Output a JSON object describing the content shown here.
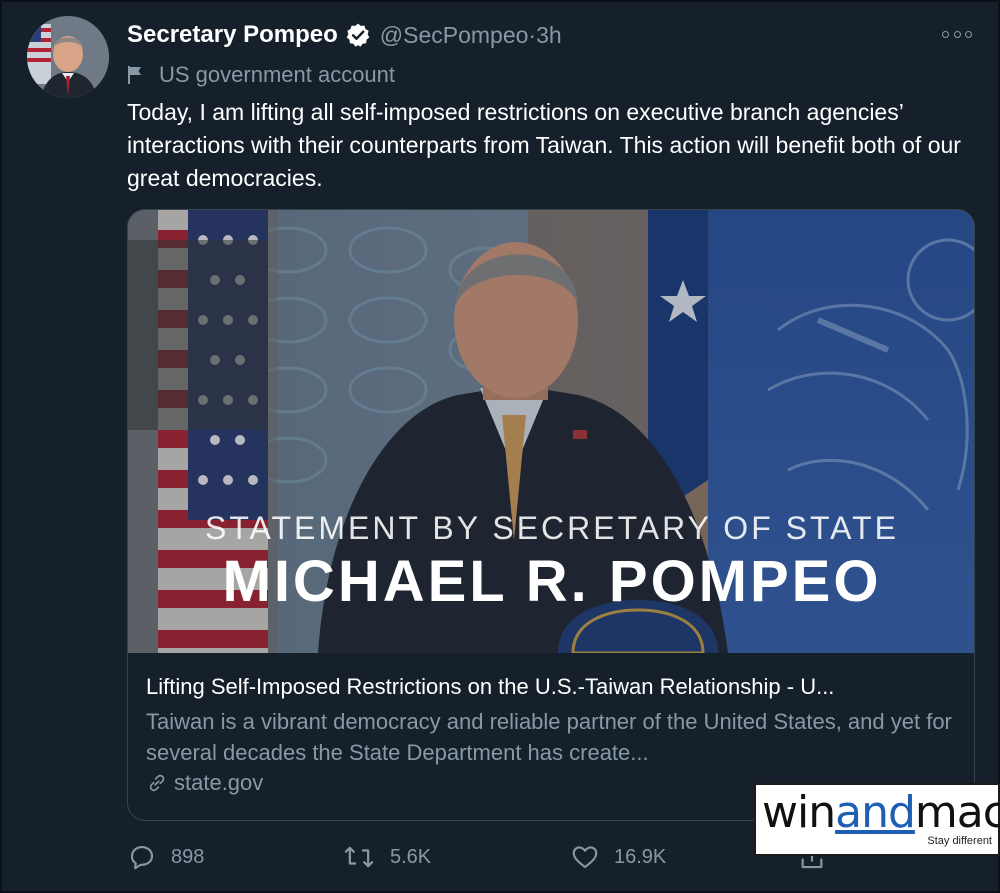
{
  "tweet": {
    "display_name": "Secretary Pompeo",
    "handle": "@SecPompeo",
    "time": "3h",
    "separator": " · ",
    "label": "US government account",
    "text": "Today, I am lifting all self-imposed restrictions on executive branch agencies’ interactions with their counterparts from Taiwan. This action will benefit both of our great democracies."
  },
  "card": {
    "image_subtitle": "STATEMENT BY SECRETARY OF STATE",
    "image_title": "MICHAEL R. POMPEO",
    "title": "Lifting Self-Imposed Restrictions on the U.S.-Taiwan Relationship - U...",
    "description": "Taiwan is a vibrant democracy and reliable partner of the United States, and yet for several decades the State Department has create...",
    "link": "state.gov"
  },
  "actions": {
    "replies": "898",
    "retweets": "5.6K",
    "likes": "16.9K"
  },
  "watermark": {
    "win": "win",
    "and": "and",
    "mac": "mac",
    "tagline": "Stay different"
  },
  "icons": [
    "verified-icon",
    "more-icon",
    "flag-icon",
    "link-icon",
    "reply-icon",
    "retweet-icon",
    "like-icon",
    "share-icon"
  ],
  "colors": {
    "background": "#15202b",
    "secondary_text": "#8899a6",
    "border": "#38444d",
    "verified": "#ffffff",
    "watermark_accent": "#1e5fb4"
  }
}
